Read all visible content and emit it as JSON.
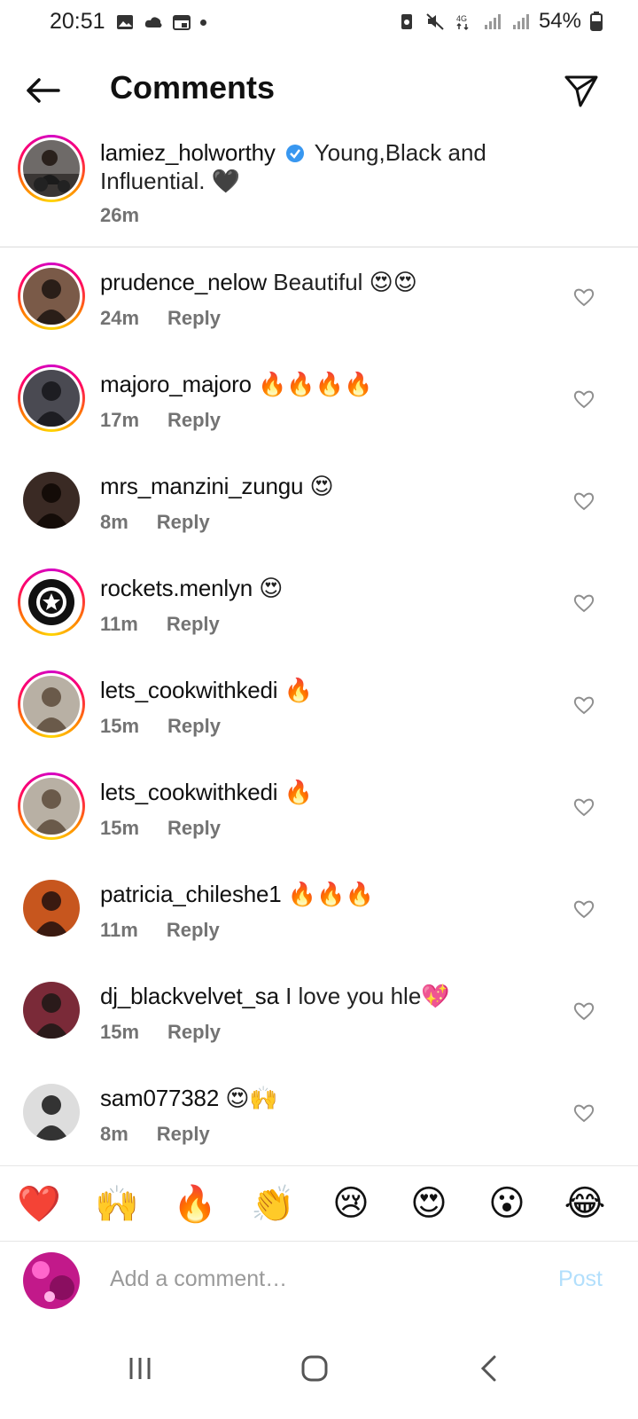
{
  "status_bar": {
    "time": "20:51",
    "battery": "54%"
  },
  "header": {
    "title": "Comments"
  },
  "caption": {
    "username": "lamiez_holworthy",
    "text": "Young,Black and Influential. 🖤",
    "time": "26m",
    "verified": true
  },
  "comments": [
    {
      "username": "prudence_nelow",
      "text": "Beautiful 😍😍",
      "time": "24m",
      "reply": "Reply",
      "ring": true
    },
    {
      "username": "majoro_majoro",
      "text": "🔥🔥🔥🔥",
      "time": "17m",
      "reply": "Reply",
      "ring": true
    },
    {
      "username": "mrs_manzini_zungu",
      "text": "😍",
      "time": "8m",
      "reply": "Reply",
      "ring": false
    },
    {
      "username": "rockets.menlyn",
      "text": "😍",
      "time": "11m",
      "reply": "Reply",
      "ring": true
    },
    {
      "username": "lets_cookwithkedi",
      "text": "🔥",
      "time": "15m",
      "reply": "Reply",
      "ring": true
    },
    {
      "username": "lets_cookwithkedi",
      "text": "🔥",
      "time": "15m",
      "reply": "Reply",
      "ring": true
    },
    {
      "username": "patricia_chileshe1",
      "text": "🔥🔥🔥",
      "time": "11m",
      "reply": "Reply",
      "ring": false
    },
    {
      "username": "dj_blackvelvet_sa",
      "text": "I love you hle💖",
      "time": "15m",
      "reply": "Reply",
      "ring": false
    },
    {
      "username": "sam077382",
      "text": "😍🙌",
      "time": "8m",
      "reply": "Reply",
      "ring": false
    }
  ],
  "reactions": [
    "❤️",
    "🙌",
    "🔥",
    "👏",
    "😢",
    "😍",
    "😮",
    "😂"
  ],
  "composer": {
    "placeholder": "Add a comment…",
    "post_label": "Post"
  },
  "colors": {
    "meta": "#737373",
    "post_disabled": "#b2dffc",
    "verified": "#3897f0",
    "divider": "#dbdbdb"
  }
}
